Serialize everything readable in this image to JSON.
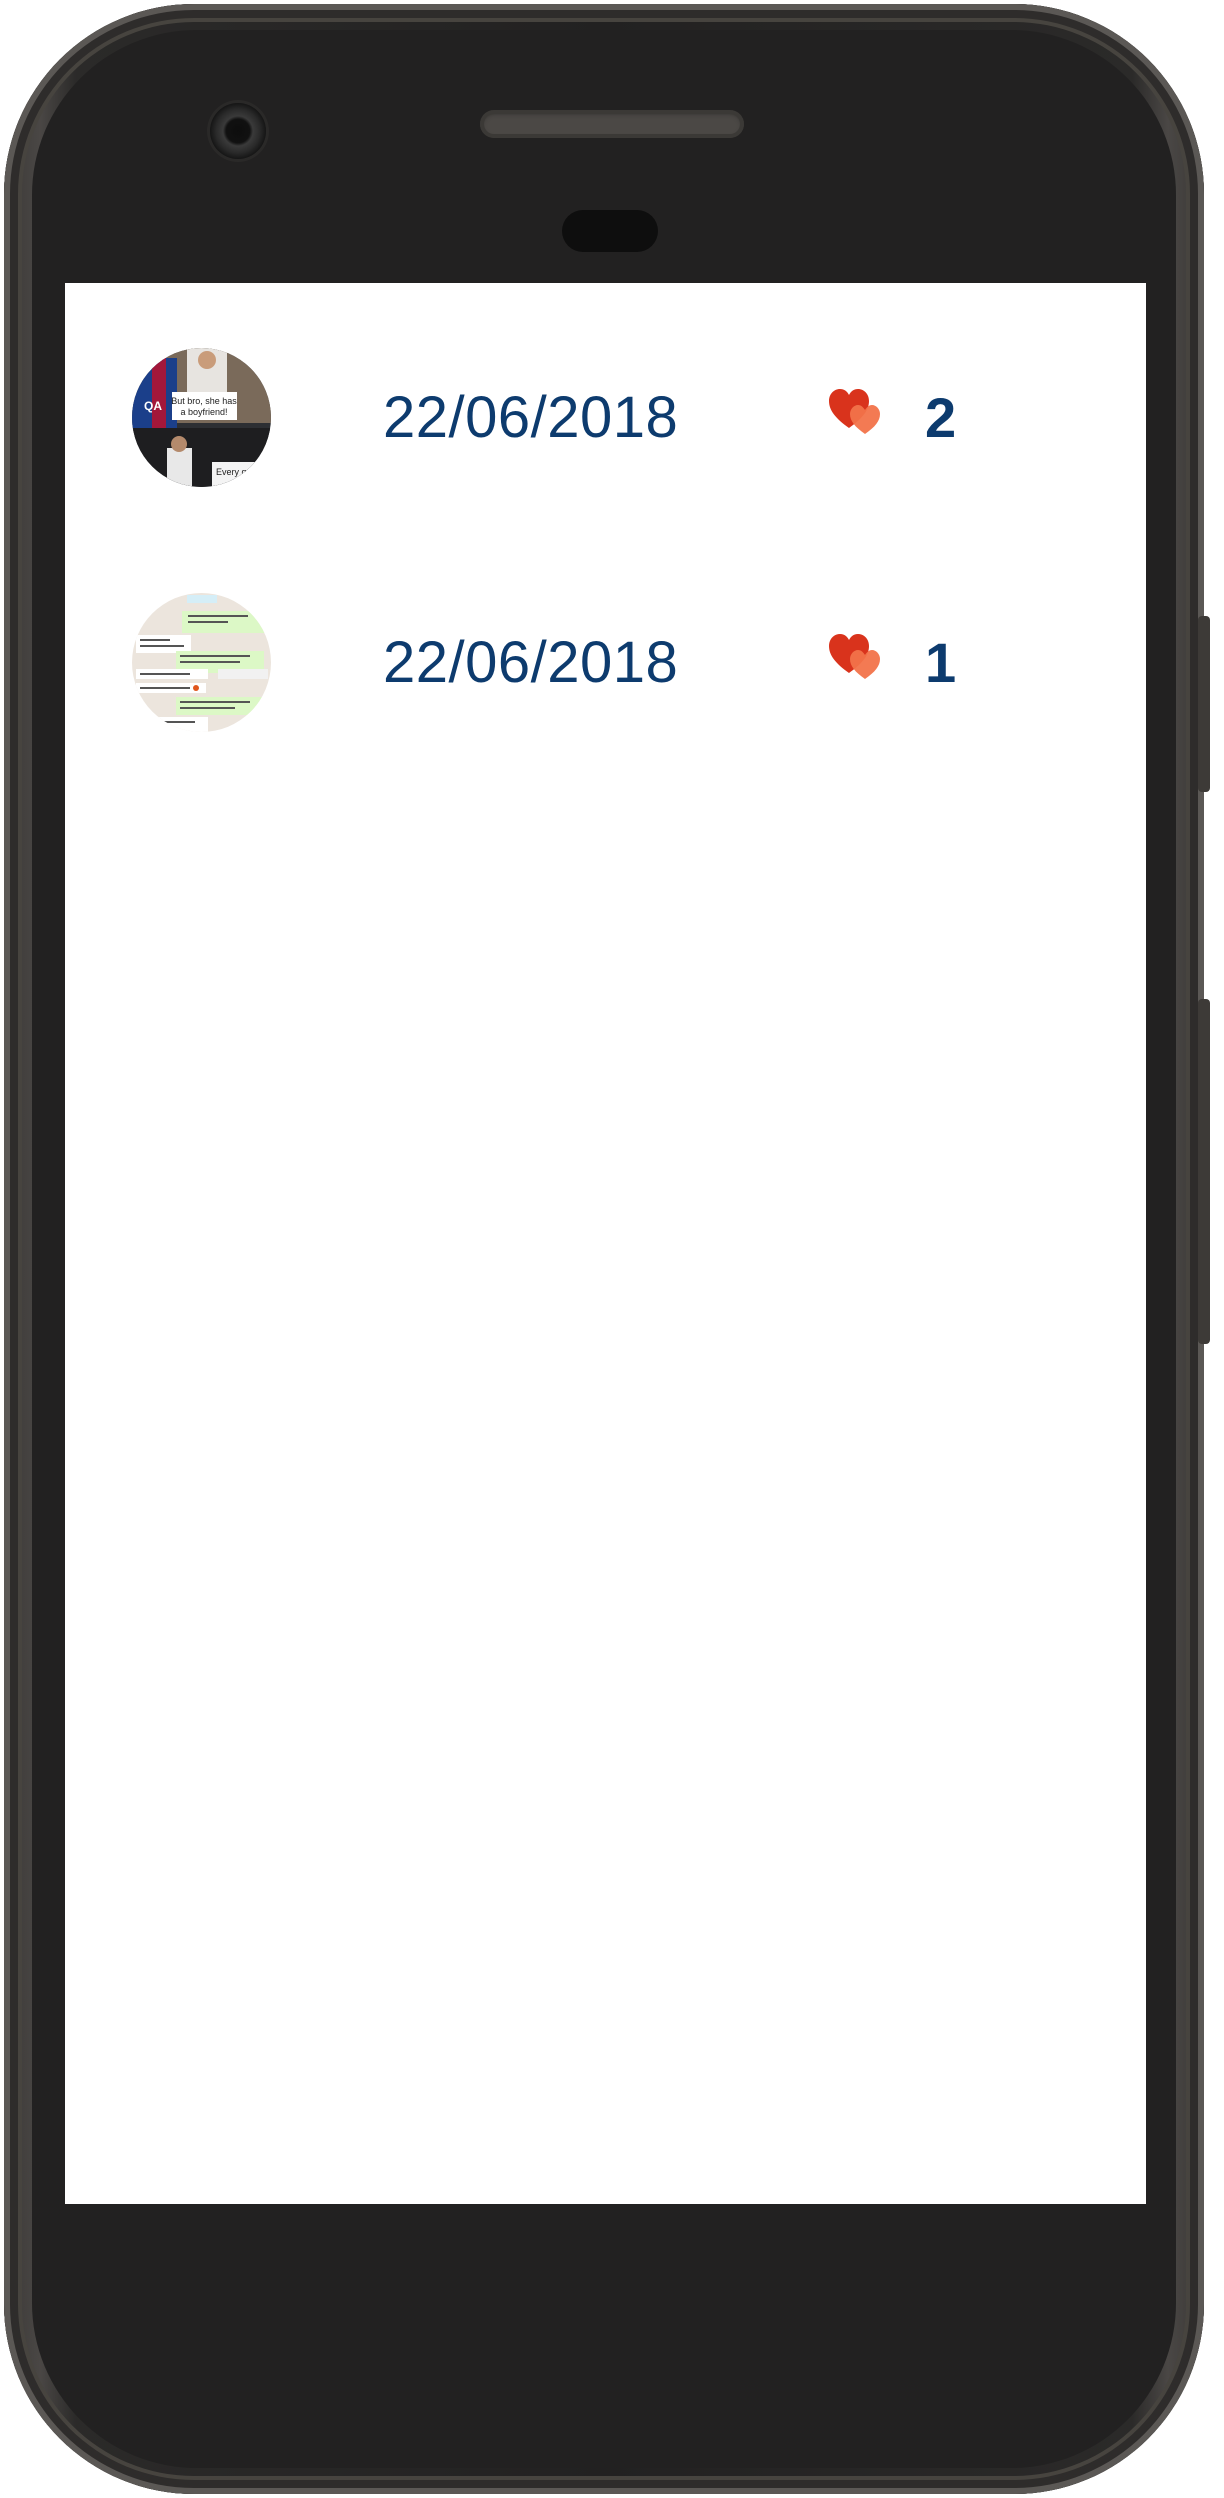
{
  "posts": [
    {
      "date": "22/06/2018",
      "likes": "2",
      "thumb_caption": "But bro, she has a boyfriend!",
      "thumb_caption_2": "Every gr..."
    },
    {
      "date": "22/06/2018",
      "likes": "1"
    }
  ],
  "icons": {
    "like": "hearts-icon"
  },
  "colors": {
    "text": "#0d3b6e",
    "heart_primary": "#d9331c",
    "heart_secondary": "#f2734a"
  }
}
